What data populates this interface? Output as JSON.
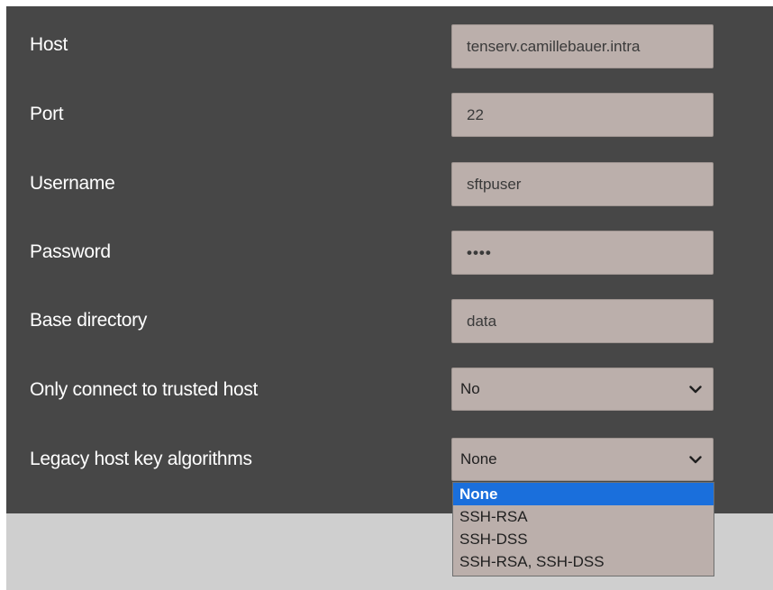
{
  "form": {
    "host": {
      "label": "Host",
      "value": "tenserv.camillebauer.intra"
    },
    "port": {
      "label": "Port",
      "value": "22"
    },
    "username": {
      "label": "Username",
      "value": "sftpuser"
    },
    "password": {
      "label": "Password",
      "value": "••••"
    },
    "base_directory": {
      "label": "Base directory",
      "value": "data"
    },
    "trusted_host": {
      "label": "Only connect to trusted host",
      "selected": "No"
    },
    "legacy_algorithms": {
      "label": "Legacy host key algorithms",
      "selected": "None",
      "options": [
        "None",
        "SSH-RSA",
        "SSH-DSS",
        "SSH-RSA, SSH-DSS"
      ]
    }
  },
  "icons": {
    "dropdown_arrow": "chevron-down-icon"
  },
  "colors": {
    "panel_background": "#474747",
    "field_background": "#bbafab",
    "selected_option": "#1a6fdc",
    "footer_background": "#cfcfcf"
  }
}
